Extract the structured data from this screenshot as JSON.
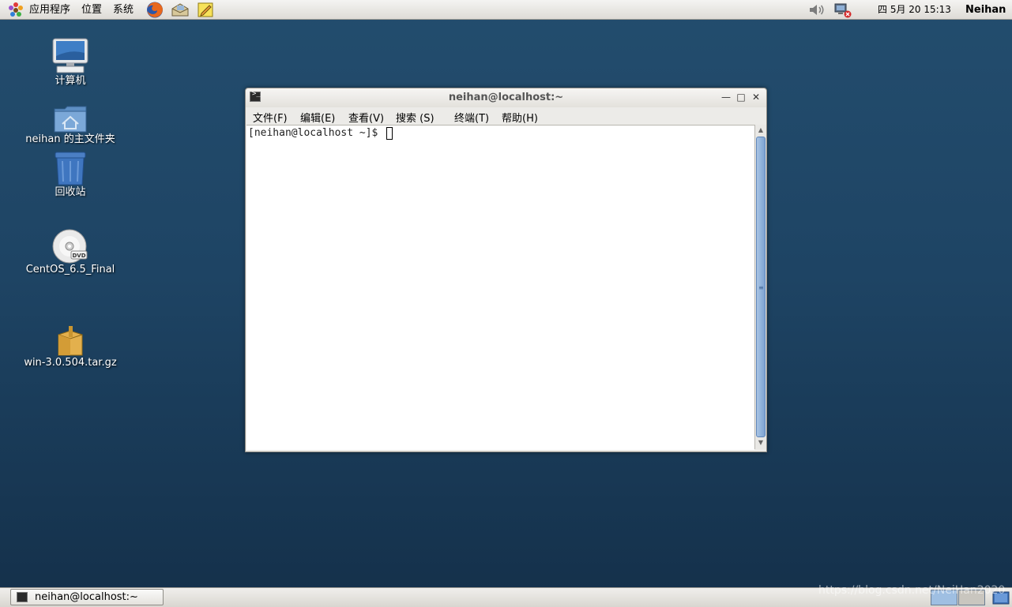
{
  "top_panel": {
    "menus": [
      "应用程序",
      "位置",
      "系统"
    ],
    "clock": "四 5月 20 15:13",
    "user": "Neihan",
    "launchers": [
      "firefox-icon",
      "mail-icon",
      "notes-icon"
    ],
    "tray": [
      "volume-icon",
      "network-disconnected-icon"
    ]
  },
  "desktop": {
    "icons": [
      {
        "label": "计算机",
        "icon": "computer-icon"
      },
      {
        "label": "neihan 的主文件夹",
        "icon": "home-folder-icon"
      },
      {
        "label": "回收站",
        "icon": "trash-icon"
      },
      {
        "label": "CentOS_6.5_Final",
        "icon": "dvd-icon"
      },
      {
        "label": "win-3.0.504.tar.gz",
        "icon": "archive-icon"
      }
    ]
  },
  "terminal": {
    "title": "neihan@localhost:~",
    "menu": [
      "文件(F)",
      "编辑(E)",
      "查看(V)",
      "搜索 (S)",
      "终端(T)",
      "帮助(H)"
    ],
    "prompt": "[neihan@localhost ~]$ "
  },
  "taskbar": {
    "task_label": "neihan@localhost:~"
  },
  "watermark": "https://blog.csdn.net/NeiHan2020",
  "colors": {
    "desktop_top": "#234d6e",
    "desktop_bottom": "#14304a",
    "scroll_thumb": "#7da3d2"
  }
}
